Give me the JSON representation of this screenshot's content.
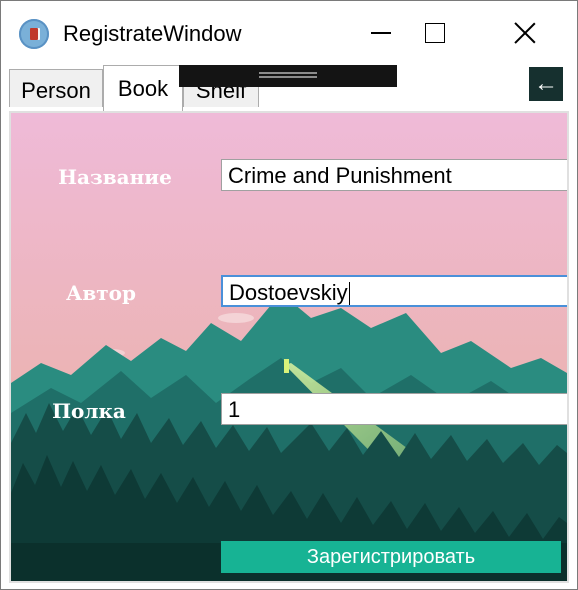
{
  "window": {
    "title": "RegistrateWindow"
  },
  "tabs": [
    {
      "label": "Person",
      "selected": false
    },
    {
      "label": "Book",
      "selected": true
    },
    {
      "label": "Shelf",
      "selected": false
    }
  ],
  "back_button": {
    "label": "←"
  },
  "form": {
    "title_label": "Название",
    "title_value": "Crime and Punishment",
    "author_label": "Автор",
    "author_value": "Dostoevskiy",
    "shelf_label": "Полка",
    "shelf_value": "1",
    "register_label": "Зарегистрировать"
  },
  "colors": {
    "accent": "#17b394",
    "sky_top": "#efbad8",
    "sky_bottom": "#e9ad9c",
    "forest": "#0e3a36"
  }
}
